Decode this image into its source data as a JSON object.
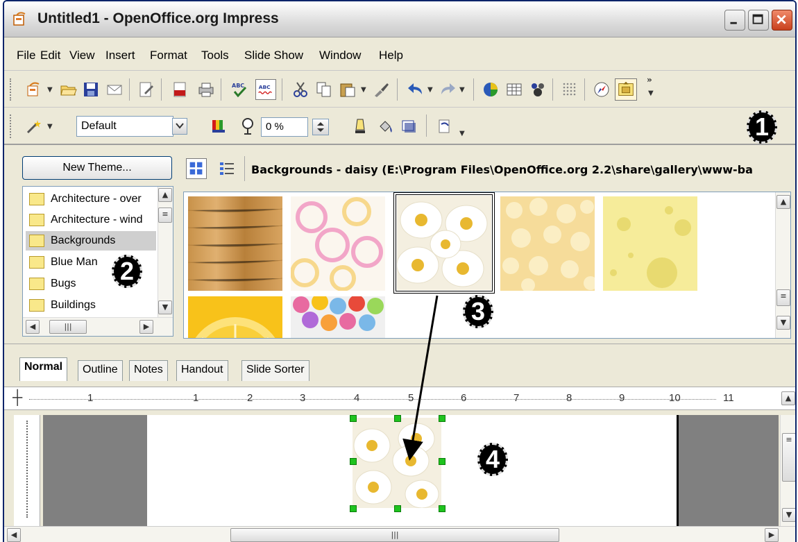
{
  "window": {
    "title": "Untitled1 - OpenOffice.org Impress"
  },
  "menu": [
    "File",
    "Edit",
    "View",
    "Insert",
    "Format",
    "Tools",
    "Slide Show",
    "Window",
    "Help"
  ],
  "toolbar2": {
    "style_value": "Default",
    "transparency_value": "0 %"
  },
  "gallery": {
    "new_theme_label": "New Theme...",
    "path_label": "Backgrounds - daisy (E:\\Program Files\\OpenOffice.org 2.2\\share\\gallery\\www-ba",
    "themes": [
      "Architecture - over",
      "Architecture - wind",
      "Backgrounds",
      "Blue Man",
      "Bugs",
      "Buildings"
    ],
    "selected_theme": "Backgrounds"
  },
  "view_tabs": [
    "Normal",
    "Outline",
    "Notes",
    "Handout",
    "Slide Sorter"
  ],
  "ruler": {
    "left_number": "1",
    "numbers": [
      "1",
      "2",
      "3",
      "4",
      "5",
      "6",
      "7",
      "8",
      "9",
      "10",
      "11"
    ]
  },
  "callouts": [
    "1",
    "2",
    "3",
    "4"
  ],
  "colors": {
    "selection_handle": "#1ec31e",
    "callout_bg": "#000000",
    "window_bg": "#ece9d8"
  }
}
